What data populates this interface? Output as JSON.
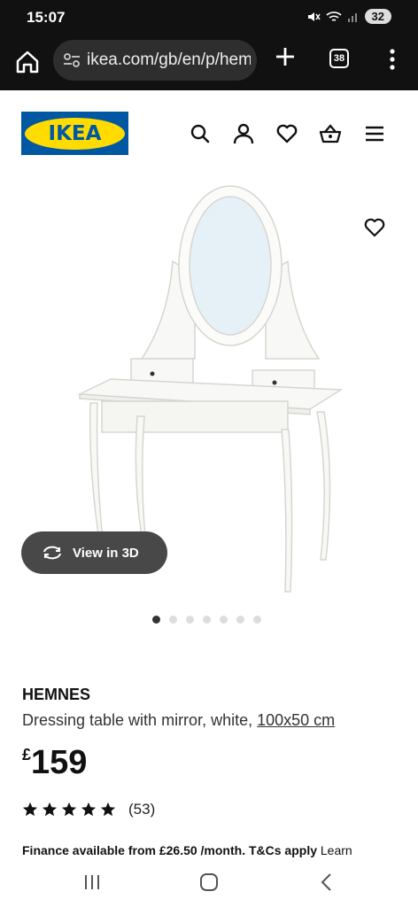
{
  "status_bar": {
    "time": "15:07",
    "battery": "32"
  },
  "browser": {
    "url": "ikea.com/gb/en/p/hemnes",
    "tab_count": "38"
  },
  "header": {
    "logo_text": "IKEA"
  },
  "gallery": {
    "view3d_label": "View in 3D",
    "image_count": 7,
    "active_index": 0
  },
  "product": {
    "name": "HEMNES",
    "description": "Dressing table with mirror, white,",
    "size": "100x50 cm",
    "currency": "£",
    "price": "159",
    "rating": 5,
    "review_count": "(53)",
    "finance_text": "Finance available from £26.50 /month. T&Cs apply",
    "finance_link": "Learn"
  },
  "colors": {
    "ikea_blue": "#0058a3",
    "ikea_yellow": "#ffdb00",
    "button_dark": "#484848"
  }
}
